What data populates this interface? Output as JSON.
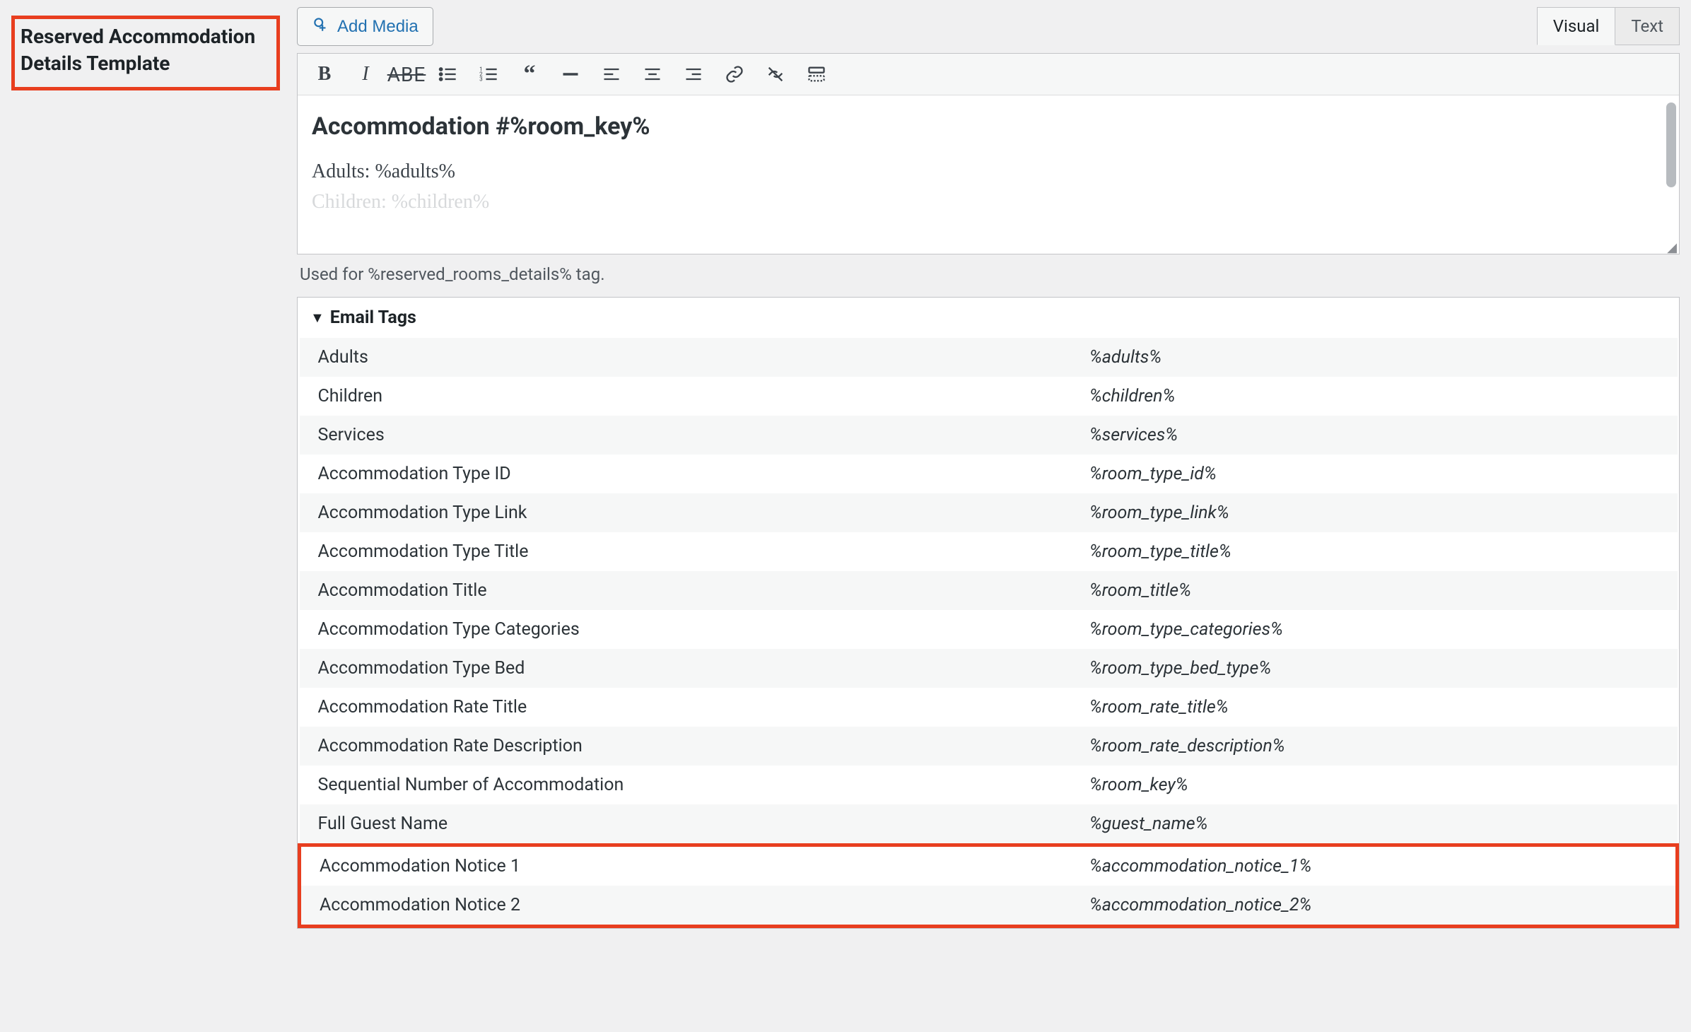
{
  "sectionLabel": "Reserved Accommodation Details Template",
  "addMediaLabel": "Add Media",
  "tabs": {
    "visual": "Visual",
    "text": "Text"
  },
  "editorContent": {
    "heading": "Accommodation #%room_key%",
    "line1": "Adults: %adults%",
    "line2": "Children: %children%"
  },
  "helperText": "Used for %reserved_rooms_details% tag.",
  "emailTagsHeader": "Email Tags",
  "emailTags": [
    {
      "label": "Adults",
      "tag": "%adults%"
    },
    {
      "label": "Children",
      "tag": "%children%"
    },
    {
      "label": "Services",
      "tag": "%services%"
    },
    {
      "label": "Accommodation Type ID",
      "tag": "%room_type_id%"
    },
    {
      "label": "Accommodation Type Link",
      "tag": "%room_type_link%"
    },
    {
      "label": "Accommodation Type Title",
      "tag": "%room_type_title%"
    },
    {
      "label": "Accommodation Title",
      "tag": "%room_title%"
    },
    {
      "label": "Accommodation Type Categories",
      "tag": "%room_type_categories%"
    },
    {
      "label": "Accommodation Type Bed",
      "tag": "%room_type_bed_type%"
    },
    {
      "label": "Accommodation Rate Title",
      "tag": "%room_rate_title%"
    },
    {
      "label": "Accommodation Rate Description",
      "tag": "%room_rate_description%"
    },
    {
      "label": "Sequential Number of Accommodation",
      "tag": "%room_key%"
    },
    {
      "label": "Full Guest Name",
      "tag": "%guest_name%"
    },
    {
      "label": "Accommodation Notice 1",
      "tag": "%accommodation_notice_1%"
    },
    {
      "label": "Accommodation Notice 2",
      "tag": "%accommodation_notice_2%"
    }
  ],
  "highlightStart": 13,
  "highlightEnd": 14
}
